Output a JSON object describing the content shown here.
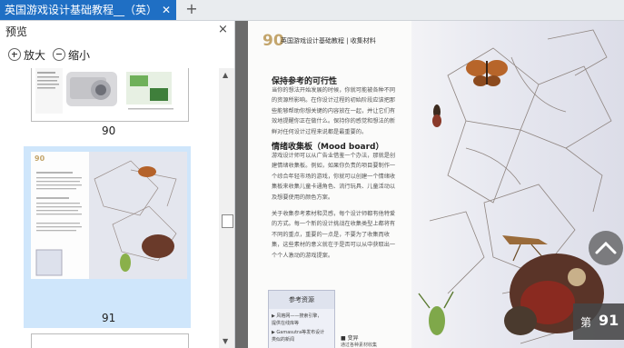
{
  "tabbar": {
    "active_tab_title": "英国游戏设计基础教程__（英）",
    "close_label": "✕",
    "new_tab_label": "+"
  },
  "panel": {
    "title": "预览",
    "close_label": "×",
    "zoom_in_label": "放大",
    "zoom_out_label": "缩小",
    "thumbnails": [
      {
        "page_number": "90",
        "selected": false
      },
      {
        "page_number": "91",
        "selected": true
      }
    ]
  },
  "page": {
    "page_number": "90",
    "header_text": "英国游戏设计基础教程 | 收集材料",
    "section1_title": "保持参考的可行性",
    "section1_body": "当你的想法开始发展的时候，你就可能被各种不同的资源所影响。在你设计过程的初始阶段应该把那些能够帮助你想关键的内容放在一起，并让它们有效地提醒你正在做什么。保持你的感觉和想法的新鲜对任何设计过程来说都是最重要的。",
    "section2_title": "情绪收集板（Mood board）",
    "section2_body": "游戏设计师可以从广告业借鉴一个办法，那就是创建情绪收集板。例如，如果你负责的项目要制作一个综合年轻市场的游戏，你就可以创建一个情绪收集板来收集儿童卡通角色、流行玩具、儿童活动以及想要使用的颜色方案。",
    "section3_body": "关于收集参考素材和灵感，每个设计师都有他特爱的方式。每一个新的设计挑战在收集类型上都将有不同的重点，重要的一点是，不要为了收集而收集，这些素材的意义就在于是否可以从中获取出一个个人激动的游戏提案。",
    "ref_box_title": "参考资源",
    "ref_items": [
      "▶ 风格网——搜索引擎，",
      "提供在线库等",
      "▶ Gamasutra等发布设计",
      "类似的新闻"
    ],
    "tip_label": "■ 变异",
    "tip_body": "通过各种素材收集"
  },
  "overlay": {
    "page_badge_prefix": "第",
    "page_badge_number": "91"
  }
}
